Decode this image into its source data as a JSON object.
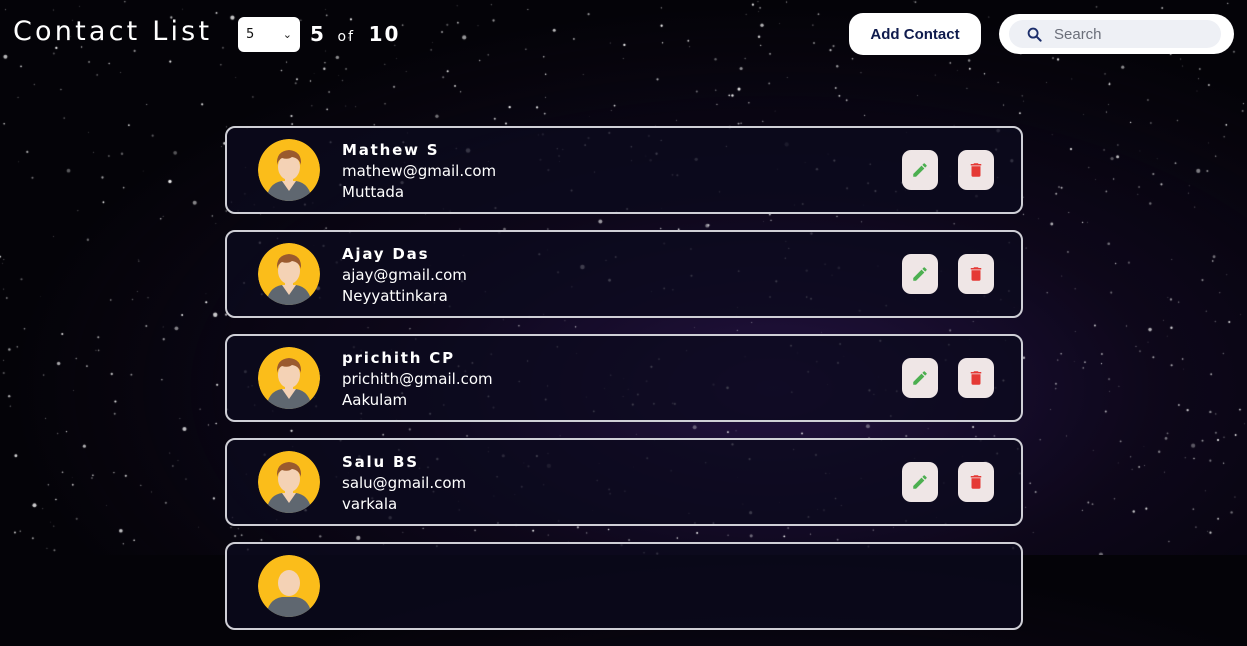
{
  "header": {
    "title": "Contact List",
    "page_size": "5",
    "shown_count": "5",
    "of_label": "of",
    "total_count": "10",
    "add_button_label": "Add Contact",
    "search_placeholder": "Search"
  },
  "contacts": [
    {
      "name": "Mathew S",
      "email": "mathew@gmail.com",
      "place": "Muttada"
    },
    {
      "name": "Ajay Das",
      "email": "ajay@gmail.com",
      "place": "Neyyattinkara"
    },
    {
      "name": "prichith CP",
      "email": "prichith@gmail.com",
      "place": "Aakulam"
    },
    {
      "name": "Salu BS",
      "email": "salu@gmail.com",
      "place": "varkala"
    },
    {
      "name": "",
      "email": "",
      "place": ""
    }
  ],
  "icons": {
    "edit": "pencil-icon",
    "delete": "trash-icon",
    "search": "search-icon",
    "select": "chevron-down-icon"
  },
  "colors": {
    "edit_icon": "#4caf50",
    "delete_icon": "#e53935",
    "button_text": "#0f1b4d",
    "action_bg": "#efe6e6",
    "avatar_bg": "#fbbd1a"
  }
}
